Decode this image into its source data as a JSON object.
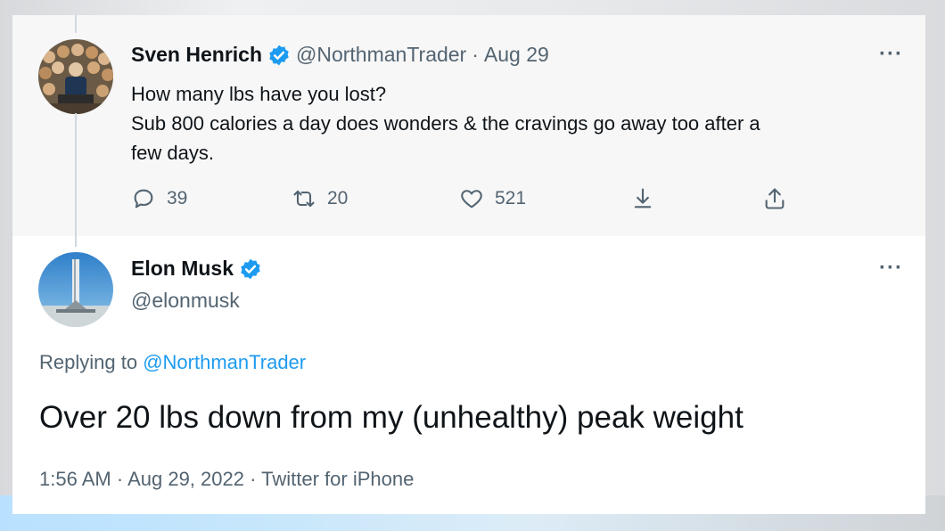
{
  "parent_tweet": {
    "author_name": "Sven Henrich",
    "author_handle": "@NorthmanTrader",
    "separator": "·",
    "date": "Aug 29",
    "text_lines": [
      "How many lbs have you lost?",
      "Sub 800 calories a day does wonders & the cravings go away too after a",
      "few days."
    ],
    "reply_count": "39",
    "retweet_count": "20",
    "like_count": "521",
    "more_label": "···"
  },
  "main_tweet": {
    "author_name": "Elon Musk",
    "author_handle": "@elonmusk",
    "replying_prefix": "Replying to",
    "replying_handle": "@NorthmanTrader",
    "text": "Over 20 lbs down from my (unhealthy) peak weight",
    "time": "1:56 AM",
    "date": "Aug 29, 2022",
    "source": "Twitter for iPhone",
    "separator": "·",
    "more_label": "···"
  },
  "colors": {
    "accent": "#1d9bf0",
    "text": "#0f1419",
    "muted": "#536471",
    "parent_bg": "#f7f7f7"
  },
  "icons": {
    "verified": "verified-badge-icon",
    "reply": "reply-icon",
    "retweet": "retweet-icon",
    "like": "heart-icon",
    "bookmark": "bookmark-icon",
    "share": "share-icon",
    "more": "more-icon"
  }
}
